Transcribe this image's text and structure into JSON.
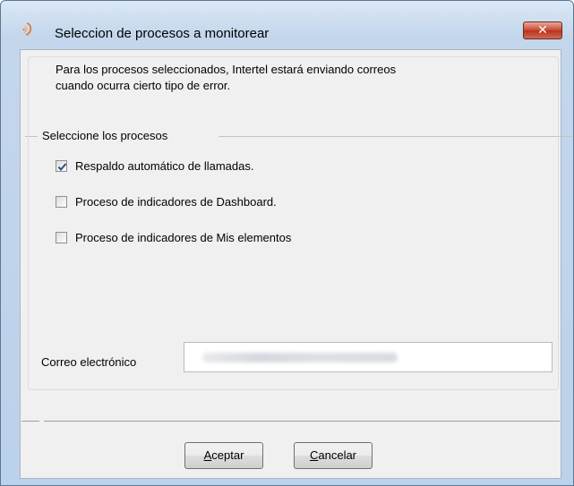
{
  "window": {
    "title": "Seleccion de procesos a monitorear",
    "close_label": "✕"
  },
  "description": {
    "line1": "Para los procesos seleccionados, Intertel estará enviando correos",
    "line2": "cuando ocurra cierto tipo de error."
  },
  "group": {
    "label": "Seleccione los procesos",
    "items": [
      {
        "label": "Respaldo automático de llamadas.",
        "checked": true
      },
      {
        "label": "Proceso de indicadores de Dashboard.",
        "checked": false
      },
      {
        "label": "Proceso de indicadores de Mis elementos",
        "checked": false
      }
    ]
  },
  "email": {
    "label": "Correo electrónico",
    "value": "(blurred)"
  },
  "buttons": {
    "accept_mnemonic": "A",
    "accept_rest": "ceptar",
    "cancel_mnemonic": "C",
    "cancel_rest": "ancelar"
  },
  "colors": {
    "titlebar": "#c3d6ec",
    "close_button": "#c9452e",
    "client_bg": "#f0f0f0"
  }
}
